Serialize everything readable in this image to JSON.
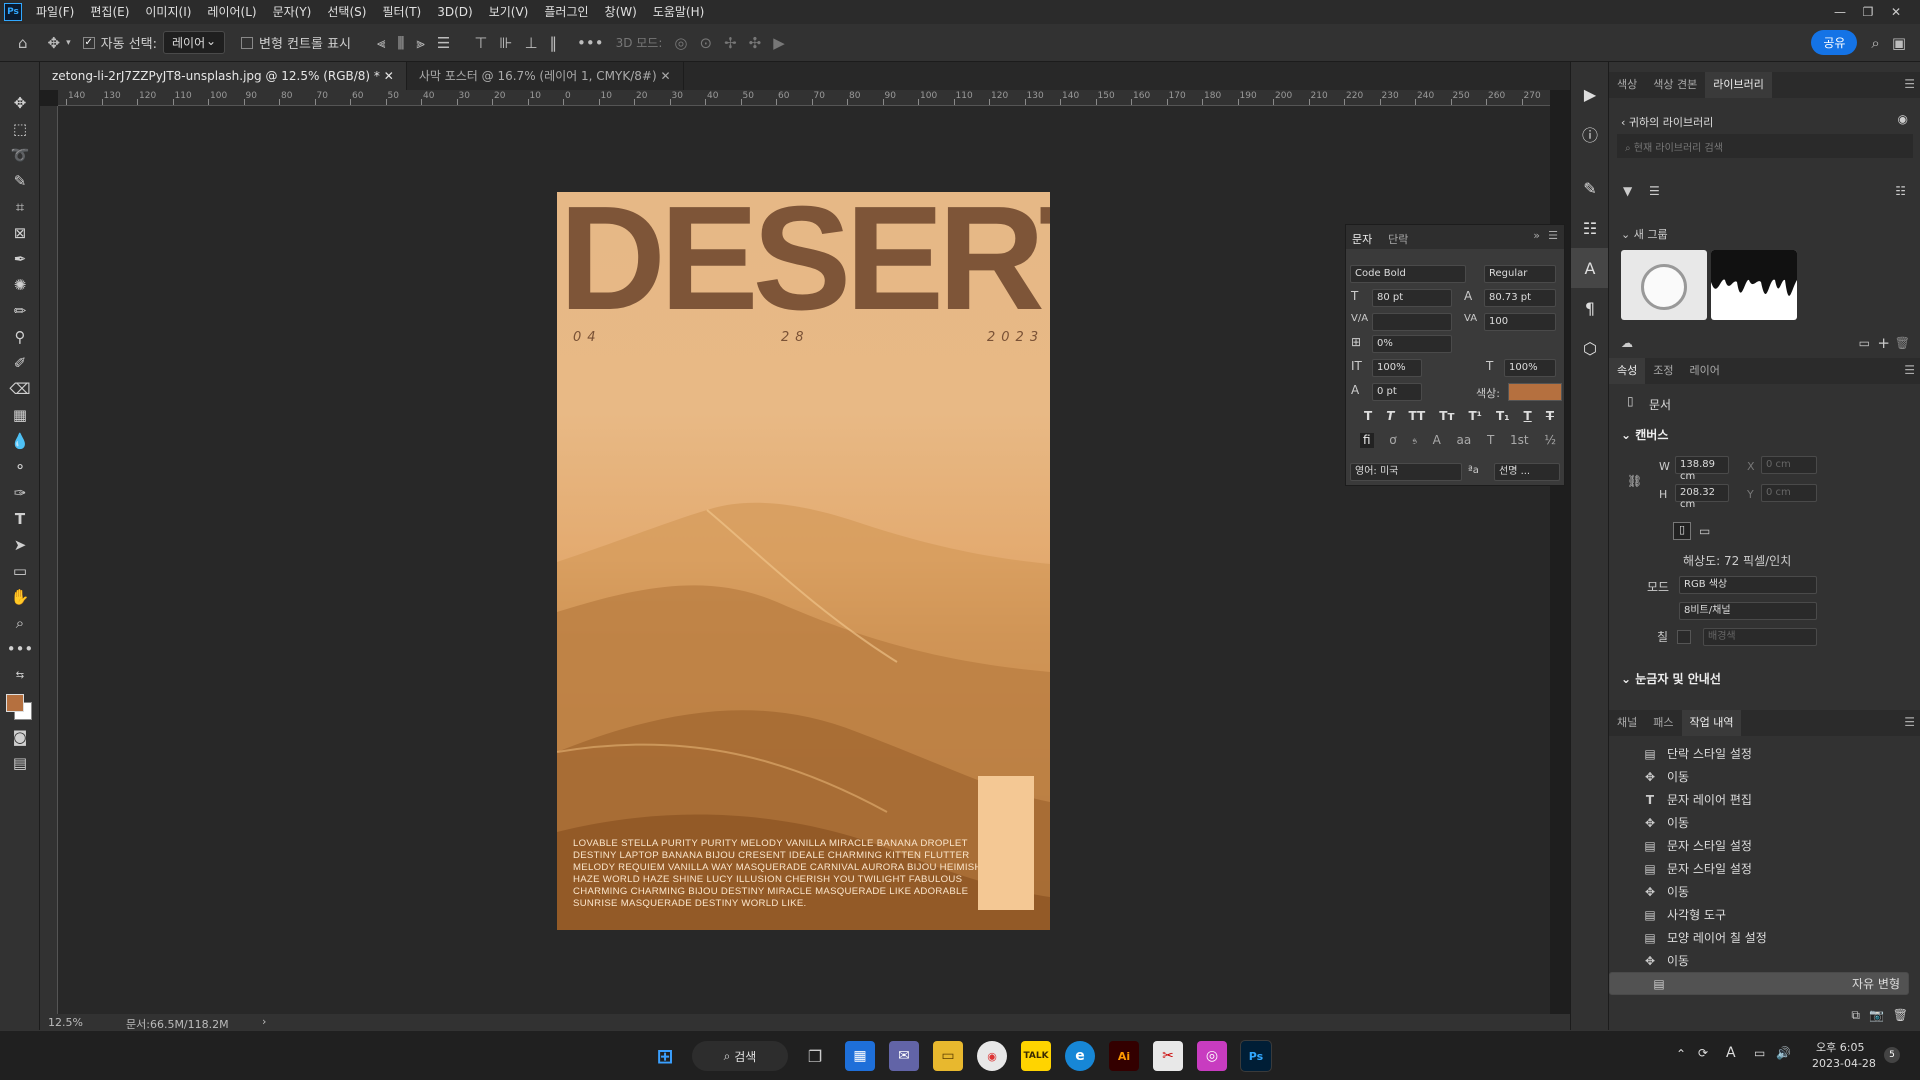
{
  "menu": {
    "items": [
      "파일(F)",
      "편집(E)",
      "이미지(I)",
      "레이어(L)",
      "문자(Y)",
      "선택(S)",
      "필터(T)",
      "3D(D)",
      "보기(V)",
      "플러그인",
      "창(W)",
      "도움말(H)"
    ]
  },
  "options": {
    "auto_select": "자동 선택:",
    "layer_select": "레이어",
    "transform_controls": "변형 컨트롤 표시",
    "mode3d": "3D 모드:",
    "share": "공유"
  },
  "tabs": [
    {
      "label": "zetong-li-2rJ7ZZPyJT8-unsplash.jpg @ 12.5% (RGB/8) *"
    },
    {
      "label": "사막 포스터 @ 16.7% (레이어 1, CMYK/8#)"
    }
  ],
  "ruler_h": [
    "140",
    "130",
    "120",
    "110",
    "100",
    "90",
    "80",
    "70",
    "60",
    "50",
    "40",
    "30",
    "20",
    "10",
    "0",
    "10",
    "20",
    "30",
    "40",
    "50",
    "60",
    "70",
    "80",
    "90",
    "100",
    "110",
    "120",
    "130",
    "140",
    "150",
    "160",
    "170",
    "180",
    "190",
    "200",
    "210",
    "220",
    "230",
    "240",
    "250",
    "260",
    "270"
  ],
  "status": {
    "zoom": "12.5%",
    "doc": "문서:66.5M/118.2M"
  },
  "poster": {
    "title": "DESERT",
    "date_1": "04",
    "date_2": "28",
    "date_3": "2023",
    "body": "LOVABLE STELLA PURITY PURITY MELODY VANILLA MIRACLE BANANA DROPLET DESTINY LAPTOP BANANA BIJOU CRESENT IDEALE CHARMING KITTEN FLUTTER MELODY REQUIEM VANILLA WAY MASQUERADE CARNIVAL AURORA BIJOU HEIMISH HAZE WORLD HAZE SHINE LUCY ILLUSION CHERISH YOU TWILIGHT FABULOUS CHARMING CHARMING BIJOU DESTINY MIRACLE MASQUERADE LIKE ADORABLE SUNRISE MASQUERADE DESTINY WORLD LIKE."
  },
  "character": {
    "tab_char": "문자",
    "tab_para": "단락",
    "font": "Code Bold",
    "style": "Regular",
    "size": "80 pt",
    "leading": "80.73 pt",
    "tracking": "100",
    "scale_pct": "0%",
    "vscale": "100%",
    "hscale": "100%",
    "baseline": "0 pt",
    "color_label": "색상:",
    "color": "#b5703f",
    "language": "영어: 미국",
    "aa": "선명 ..."
  },
  "libraries": {
    "tabs": [
      "색상",
      "색상 견본",
      "라이브러리"
    ],
    "back": "귀하의 라이브러리",
    "search_placeholder": "현재 라이브러리 검색",
    "group": "새 그룹"
  },
  "properties": {
    "tabs": [
      "속성",
      "조정",
      "레이어"
    ],
    "doc_label": "문서",
    "canvas": "캔버스",
    "w_label": "W",
    "w": "138.89 cm",
    "h_label": "H",
    "h": "208.32 cm",
    "x_label": "X",
    "x": "0 cm",
    "y_label": "Y",
    "y": "0 cm",
    "resolution": "해상도: 72 픽셀/인치",
    "mode_label": "모드",
    "mode": "RGB 색상",
    "bits": "8비트/채널",
    "fill_label": "칠",
    "fill": "배경색",
    "rulers": "눈금자 및 안내선"
  },
  "history": {
    "tabs": [
      "채널",
      "패스",
      "작업 내역"
    ],
    "items": [
      {
        "icon": "doc-icon",
        "label": "단락 스타일 설정"
      },
      {
        "icon": "move-icon",
        "label": "이동"
      },
      {
        "icon": "type-icon",
        "label": "문자 레이어 편집"
      },
      {
        "icon": "move-icon",
        "label": "이동"
      },
      {
        "icon": "doc-icon",
        "label": "문자 스타일 설정"
      },
      {
        "icon": "doc-icon",
        "label": "문자 스타일 설정"
      },
      {
        "icon": "move-icon",
        "label": "이동"
      },
      {
        "icon": "doc-icon",
        "label": "사각형 도구"
      },
      {
        "icon": "doc-icon",
        "label": "모양 레이어 칠 설정"
      },
      {
        "icon": "move-icon",
        "label": "이동"
      },
      {
        "icon": "doc-icon",
        "label": "자유 변형"
      }
    ]
  },
  "taskbar": {
    "search": "검색",
    "time": "오후 6:05",
    "date": "2023-04-28",
    "lang": "A",
    "notif": "5"
  }
}
